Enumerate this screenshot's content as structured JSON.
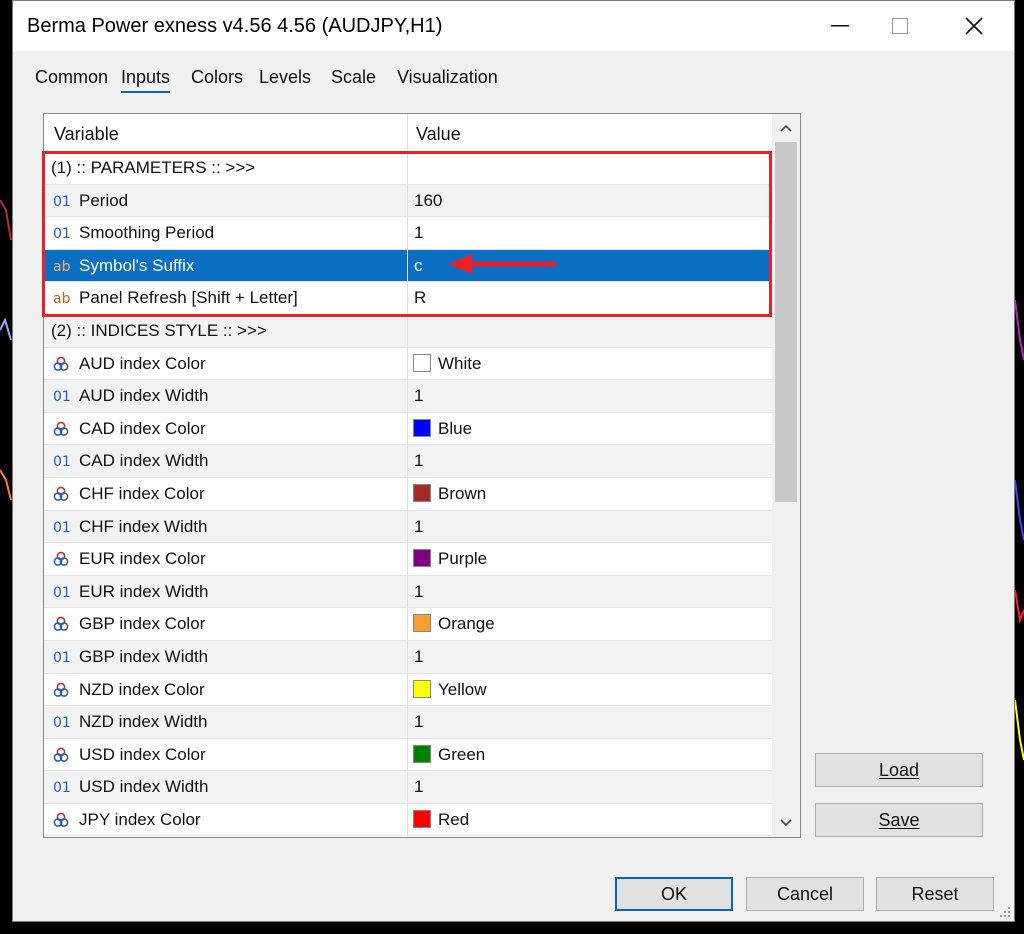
{
  "window": {
    "title": "Berma Power exness v4.56 4.56 (AUDJPY,H1)",
    "minimize_icon": "minimize-icon",
    "maximize_icon": "maximize-icon",
    "close_icon": "close-icon"
  },
  "tabs": [
    {
      "label": "Common"
    },
    {
      "label": "Inputs",
      "active": true
    },
    {
      "label": "Colors"
    },
    {
      "label": "Levels"
    },
    {
      "label": "Scale"
    },
    {
      "label": "Visualization"
    }
  ],
  "table": {
    "headers": {
      "variable": "Variable",
      "value": "Value"
    },
    "rows": [
      {
        "type": "group",
        "label": "(1) :: PARAMETERS :: >>>",
        "value": ""
      },
      {
        "type": "int",
        "icon": "01",
        "label": "Period",
        "value": "160"
      },
      {
        "type": "int",
        "icon": "01",
        "label": "Smoothing Period",
        "value": "1"
      },
      {
        "type": "string",
        "icon": "ab",
        "label": "Symbol's Suffix",
        "value": "c",
        "selected": true
      },
      {
        "type": "string",
        "icon": "ab",
        "label": "Panel Refresh [Shift + Letter]",
        "value": "R"
      },
      {
        "type": "group",
        "label": "(2) :: INDICES STYLE :: >>>",
        "value": ""
      },
      {
        "type": "color",
        "icon": "color-icon",
        "label": "AUD index Color",
        "value": "White",
        "swatch": "#ffffff"
      },
      {
        "type": "int",
        "icon": "01",
        "label": "AUD index Width",
        "value": "1"
      },
      {
        "type": "color",
        "icon": "color-icon",
        "label": "CAD index Color",
        "value": "Blue",
        "swatch": "#0000ff"
      },
      {
        "type": "int",
        "icon": "01",
        "label": "CAD index Width",
        "value": "1"
      },
      {
        "type": "color",
        "icon": "color-icon",
        "label": "CHF index Color",
        "value": "Brown",
        "swatch": "#a52a2a"
      },
      {
        "type": "int",
        "icon": "01",
        "label": "CHF index Width",
        "value": "1"
      },
      {
        "type": "color",
        "icon": "color-icon",
        "label": "EUR index Color",
        "value": "Purple",
        "swatch": "#800080"
      },
      {
        "type": "int",
        "icon": "01",
        "label": "EUR index Width",
        "value": "1"
      },
      {
        "type": "color",
        "icon": "color-icon",
        "label": "GBP index Color",
        "value": "Orange",
        "swatch": "#f5a030"
      },
      {
        "type": "int",
        "icon": "01",
        "label": "GBP index Width",
        "value": "1"
      },
      {
        "type": "color",
        "icon": "color-icon",
        "label": "NZD index Color",
        "value": "Yellow",
        "swatch": "#ffff00"
      },
      {
        "type": "int",
        "icon": "01",
        "label": "NZD index Width",
        "value": "1"
      },
      {
        "type": "color",
        "icon": "color-icon",
        "label": "USD index Color",
        "value": "Green",
        "swatch": "#008000"
      },
      {
        "type": "int",
        "icon": "01",
        "label": "USD index Width",
        "value": "1"
      },
      {
        "type": "color",
        "icon": "color-icon",
        "label": "JPY index Color",
        "value": "Red",
        "swatch": "#ff0000"
      }
    ]
  },
  "side_buttons": {
    "load": "Load",
    "save": "Save"
  },
  "footer_buttons": {
    "ok": "OK",
    "cancel": "Cancel",
    "reset": "Reset"
  },
  "colors": {
    "accent": "#0a64c8",
    "selection": "#0a6fc2",
    "highlight": "#e8202a"
  }
}
